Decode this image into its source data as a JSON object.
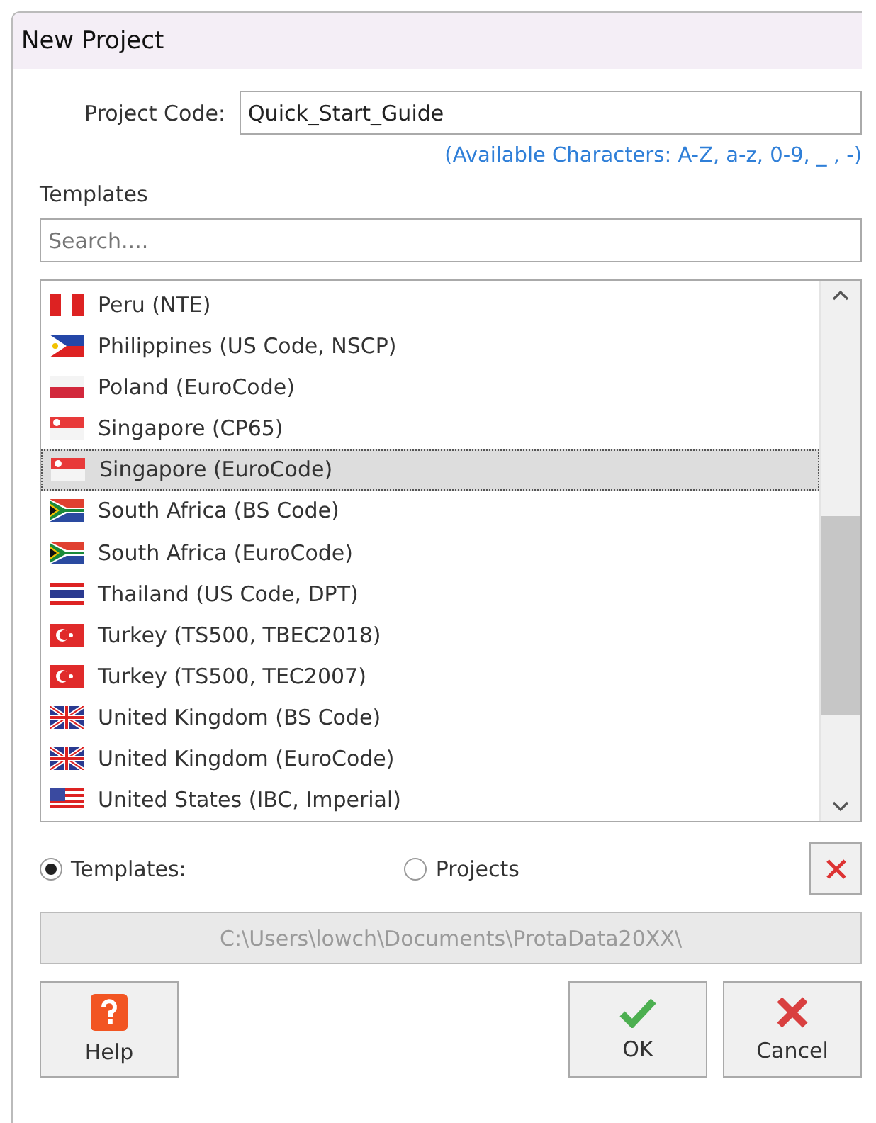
{
  "window": {
    "title": "New Project"
  },
  "project_code": {
    "label": "Project Code:",
    "value": "Quick_Start_Guide"
  },
  "hint": "(Available Characters: A-Z, a-z, 0-9, _ , -)",
  "templates_label": "Templates",
  "search": {
    "placeholder": "Search...."
  },
  "templates": [
    {
      "label": "Peru (NTE)",
      "kind": "peru",
      "selected": false
    },
    {
      "label": "Philippines (US Code, NSCP)",
      "kind": "philippines",
      "selected": false
    },
    {
      "label": "Poland (EuroCode)",
      "kind": "poland",
      "selected": false
    },
    {
      "label": "Singapore (CP65)",
      "kind": "singapore",
      "selected": false
    },
    {
      "label": "Singapore (EuroCode)",
      "kind": "singapore",
      "selected": true
    },
    {
      "label": "South Africa (BS Code)",
      "kind": "southafrica",
      "selected": false
    },
    {
      "label": "South Africa (EuroCode)",
      "kind": "southafrica",
      "selected": false
    },
    {
      "label": "Thailand (US Code, DPT)",
      "kind": "thailand",
      "selected": false
    },
    {
      "label": "Turkey (TS500, TBEC2018)",
      "kind": "turkey",
      "selected": false
    },
    {
      "label": "Turkey (TS500, TEC2007)",
      "kind": "turkey",
      "selected": false
    },
    {
      "label": "United Kingdom (BS Code)",
      "kind": "uk",
      "selected": false
    },
    {
      "label": "United Kingdom (EuroCode)",
      "kind": "uk",
      "selected": false
    },
    {
      "label": "United States (IBC, Imperial)",
      "kind": "us",
      "selected": false
    }
  ],
  "source": [
    {
      "label": "Templates:",
      "selected": true
    },
    {
      "label": "Projects",
      "selected": false
    }
  ],
  "path": "C:\\Users\\lowch\\Documents\\ProtaData20XX\\",
  "buttons": [
    {
      "label": "Help",
      "kind": "help"
    },
    {
      "label": "OK",
      "kind": "ok"
    },
    {
      "label": "Cancel",
      "kind": "cancel"
    }
  ]
}
